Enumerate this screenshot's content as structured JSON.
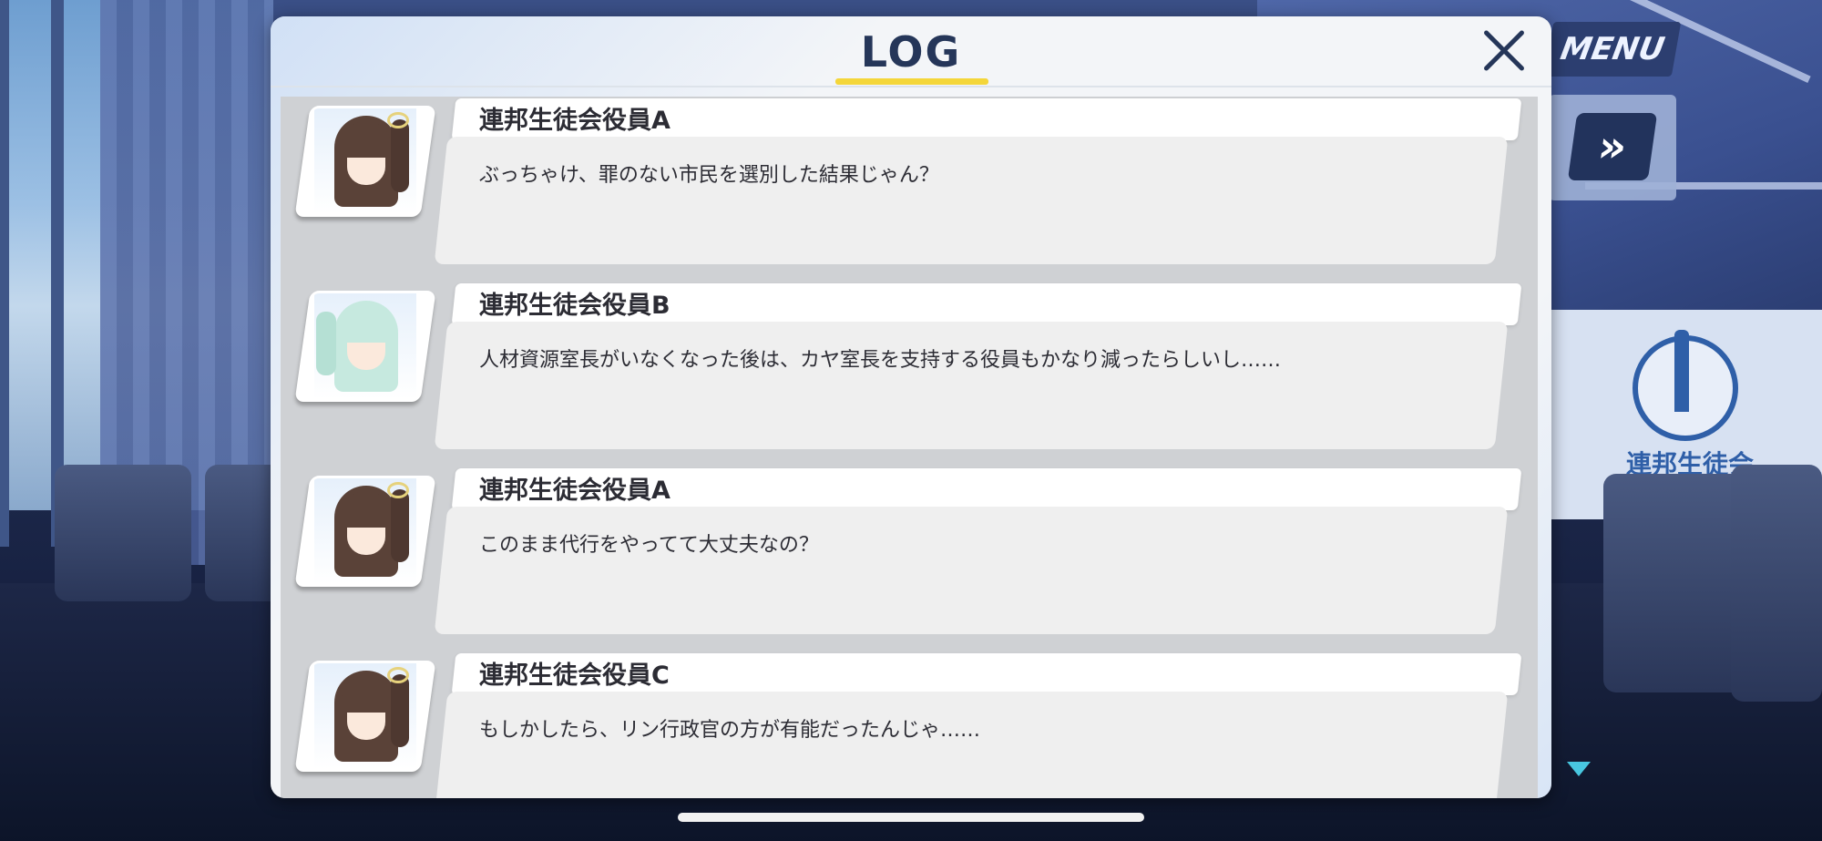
{
  "header": {
    "title": "LOG",
    "menu_label": "MENU",
    "fast_forward_glyph": "»",
    "close_icon": "close-icon"
  },
  "background": {
    "emblem_text": "連邦生徒会"
  },
  "colors": {
    "title_text": "#253659",
    "title_underline": "#f4d63a",
    "panel_bg": "#f3f5f8",
    "message_bg": "#efefef",
    "scroll_arrow": "#48c7e0"
  },
  "log": {
    "entries": [
      {
        "speaker": "連邦生徒会役員A",
        "message": "ぶっちゃけ、罪のない市民を選別した結果じゃん？",
        "avatar": "brown-ponytail-avatar"
      },
      {
        "speaker": "連邦生徒会役員B",
        "message": "人材資源室長がいなくなった後は、カヤ室長を支持する役員もかなり減ったらしいし……",
        "avatar": "mint-twintail-avatar"
      },
      {
        "speaker": "連邦生徒会役員A",
        "message": "このまま代行をやってて大丈夫なの？",
        "avatar": "brown-ponytail-avatar"
      },
      {
        "speaker": "連邦生徒会役員C",
        "message": "もしかしたら、リン行政官の方が有能だったんじゃ……",
        "avatar": "brown-ponytail-avatar"
      }
    ]
  }
}
